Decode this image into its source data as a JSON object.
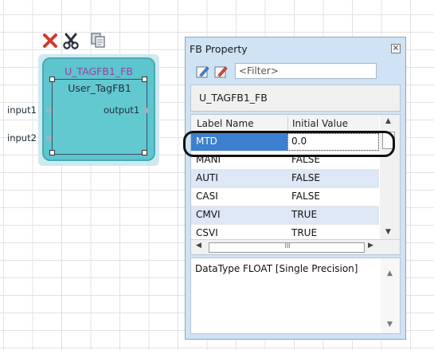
{
  "canvas": {
    "edit_toolbar": {
      "tools": [
        {
          "icon": "delete-icon"
        },
        {
          "icon": "cut-icon"
        },
        {
          "icon": "copy-icon"
        }
      ]
    },
    "fb_block": {
      "instance_name": "U_TAGFB1_FB",
      "type_name": "User_TagFB1",
      "inputs": [
        "input1",
        "input2"
      ],
      "outputs": [
        "output1"
      ],
      "colors": {
        "body": "#5cc5ce",
        "instance_name": "#9b40a8"
      }
    }
  },
  "property_window": {
    "title": "FB Property",
    "close_icon": "close-icon",
    "filter": {
      "placeholder": "<Filter>",
      "value": ""
    },
    "fb_name": "U_TAGFB1_FB",
    "columns": [
      "Label Name",
      "Initial Value"
    ],
    "rows": [
      {
        "label": "MTD",
        "value": "0.0",
        "selected": true
      },
      {
        "label": "MANI",
        "value": "FALSE"
      },
      {
        "label": "AUTI",
        "value": "FALSE"
      },
      {
        "label": "CASI",
        "value": "FALSE"
      },
      {
        "label": "CMVI",
        "value": "TRUE"
      },
      {
        "label": "CSVI",
        "value": "TRUE"
      }
    ],
    "hscroll_grip": "III",
    "description": "DataType FLOAT [Single Precision]",
    "colors": {
      "selected_row": "#3d7fd0",
      "alt_row": "#dde7f5",
      "panel": "#cfe3f4"
    }
  }
}
